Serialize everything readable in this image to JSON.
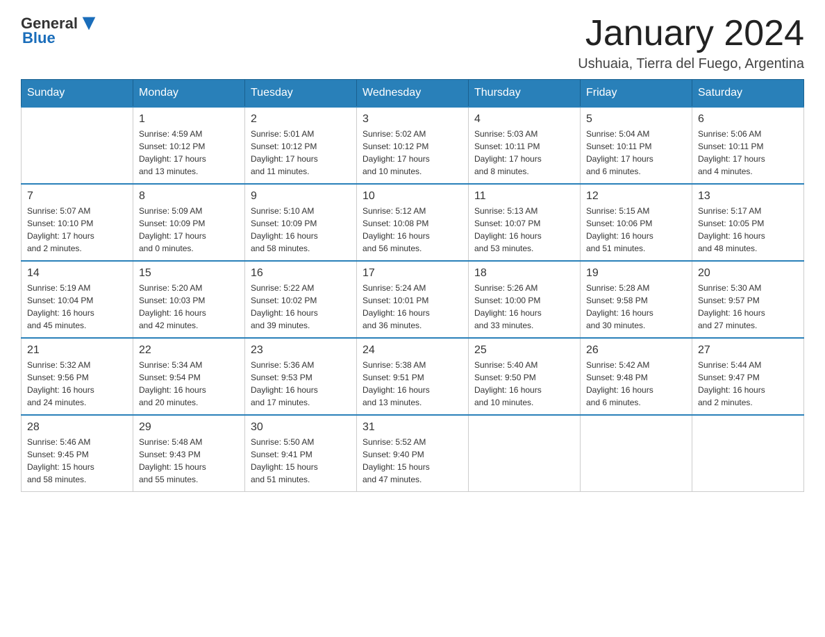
{
  "header": {
    "logo": {
      "text_general": "General",
      "text_blue": "Blue",
      "alt": "GeneralBlue logo"
    },
    "title": "January 2024",
    "subtitle": "Ushuaia, Tierra del Fuego, Argentina"
  },
  "weekdays": [
    "Sunday",
    "Monday",
    "Tuesday",
    "Wednesday",
    "Thursday",
    "Friday",
    "Saturday"
  ],
  "weeks": [
    [
      {
        "day": "",
        "info": ""
      },
      {
        "day": "1",
        "info": "Sunrise: 4:59 AM\nSunset: 10:12 PM\nDaylight: 17 hours\nand 13 minutes."
      },
      {
        "day": "2",
        "info": "Sunrise: 5:01 AM\nSunset: 10:12 PM\nDaylight: 17 hours\nand 11 minutes."
      },
      {
        "day": "3",
        "info": "Sunrise: 5:02 AM\nSunset: 10:12 PM\nDaylight: 17 hours\nand 10 minutes."
      },
      {
        "day": "4",
        "info": "Sunrise: 5:03 AM\nSunset: 10:11 PM\nDaylight: 17 hours\nand 8 minutes."
      },
      {
        "day": "5",
        "info": "Sunrise: 5:04 AM\nSunset: 10:11 PM\nDaylight: 17 hours\nand 6 minutes."
      },
      {
        "day": "6",
        "info": "Sunrise: 5:06 AM\nSunset: 10:11 PM\nDaylight: 17 hours\nand 4 minutes."
      }
    ],
    [
      {
        "day": "7",
        "info": "Sunrise: 5:07 AM\nSunset: 10:10 PM\nDaylight: 17 hours\nand 2 minutes."
      },
      {
        "day": "8",
        "info": "Sunrise: 5:09 AM\nSunset: 10:09 PM\nDaylight: 17 hours\nand 0 minutes."
      },
      {
        "day": "9",
        "info": "Sunrise: 5:10 AM\nSunset: 10:09 PM\nDaylight: 16 hours\nand 58 minutes."
      },
      {
        "day": "10",
        "info": "Sunrise: 5:12 AM\nSunset: 10:08 PM\nDaylight: 16 hours\nand 56 minutes."
      },
      {
        "day": "11",
        "info": "Sunrise: 5:13 AM\nSunset: 10:07 PM\nDaylight: 16 hours\nand 53 minutes."
      },
      {
        "day": "12",
        "info": "Sunrise: 5:15 AM\nSunset: 10:06 PM\nDaylight: 16 hours\nand 51 minutes."
      },
      {
        "day": "13",
        "info": "Sunrise: 5:17 AM\nSunset: 10:05 PM\nDaylight: 16 hours\nand 48 minutes."
      }
    ],
    [
      {
        "day": "14",
        "info": "Sunrise: 5:19 AM\nSunset: 10:04 PM\nDaylight: 16 hours\nand 45 minutes."
      },
      {
        "day": "15",
        "info": "Sunrise: 5:20 AM\nSunset: 10:03 PM\nDaylight: 16 hours\nand 42 minutes."
      },
      {
        "day": "16",
        "info": "Sunrise: 5:22 AM\nSunset: 10:02 PM\nDaylight: 16 hours\nand 39 minutes."
      },
      {
        "day": "17",
        "info": "Sunrise: 5:24 AM\nSunset: 10:01 PM\nDaylight: 16 hours\nand 36 minutes."
      },
      {
        "day": "18",
        "info": "Sunrise: 5:26 AM\nSunset: 10:00 PM\nDaylight: 16 hours\nand 33 minutes."
      },
      {
        "day": "19",
        "info": "Sunrise: 5:28 AM\nSunset: 9:58 PM\nDaylight: 16 hours\nand 30 minutes."
      },
      {
        "day": "20",
        "info": "Sunrise: 5:30 AM\nSunset: 9:57 PM\nDaylight: 16 hours\nand 27 minutes."
      }
    ],
    [
      {
        "day": "21",
        "info": "Sunrise: 5:32 AM\nSunset: 9:56 PM\nDaylight: 16 hours\nand 24 minutes."
      },
      {
        "day": "22",
        "info": "Sunrise: 5:34 AM\nSunset: 9:54 PM\nDaylight: 16 hours\nand 20 minutes."
      },
      {
        "day": "23",
        "info": "Sunrise: 5:36 AM\nSunset: 9:53 PM\nDaylight: 16 hours\nand 17 minutes."
      },
      {
        "day": "24",
        "info": "Sunrise: 5:38 AM\nSunset: 9:51 PM\nDaylight: 16 hours\nand 13 minutes."
      },
      {
        "day": "25",
        "info": "Sunrise: 5:40 AM\nSunset: 9:50 PM\nDaylight: 16 hours\nand 10 minutes."
      },
      {
        "day": "26",
        "info": "Sunrise: 5:42 AM\nSunset: 9:48 PM\nDaylight: 16 hours\nand 6 minutes."
      },
      {
        "day": "27",
        "info": "Sunrise: 5:44 AM\nSunset: 9:47 PM\nDaylight: 16 hours\nand 2 minutes."
      }
    ],
    [
      {
        "day": "28",
        "info": "Sunrise: 5:46 AM\nSunset: 9:45 PM\nDaylight: 15 hours\nand 58 minutes."
      },
      {
        "day": "29",
        "info": "Sunrise: 5:48 AM\nSunset: 9:43 PM\nDaylight: 15 hours\nand 55 minutes."
      },
      {
        "day": "30",
        "info": "Sunrise: 5:50 AM\nSunset: 9:41 PM\nDaylight: 15 hours\nand 51 minutes."
      },
      {
        "day": "31",
        "info": "Sunrise: 5:52 AM\nSunset: 9:40 PM\nDaylight: 15 hours\nand 47 minutes."
      },
      {
        "day": "",
        "info": ""
      },
      {
        "day": "",
        "info": ""
      },
      {
        "day": "",
        "info": ""
      }
    ]
  ]
}
